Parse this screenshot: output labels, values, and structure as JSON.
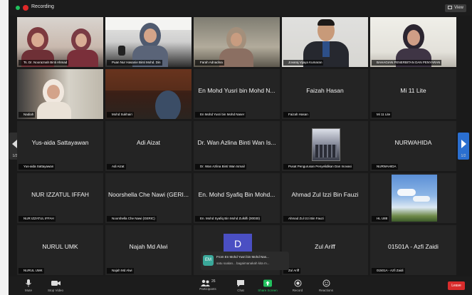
{
  "topbar": {
    "recording_label": "Recording",
    "view_label": "View"
  },
  "nav": {
    "left_page": "1/2",
    "right_page": "1/2"
  },
  "tiles": [
    {
      "name": "",
      "label": "Ts. Dr. Nooraznah Binti Ahmad"
    },
    {
      "name": "",
      "label": "Puan Nur Hasanie Binti Mohd. Din"
    },
    {
      "name": "",
      "label": "Farah Adnadina"
    },
    {
      "name": "",
      "label": "Jovaraj Vijaya Kumaran"
    },
    {
      "name": "",
      "label": "BAHAGIAN PENERBITAN DAN PENYARAN"
    },
    {
      "name": "",
      "label": "Nadiah"
    },
    {
      "name": "",
      "label": "Mohd Sukhairi"
    },
    {
      "name": "En Mohd Yusri bin Mohd N...",
      "label": "En Mohd Yusri bin Mohd Naser"
    },
    {
      "name": "Faizah Hasan",
      "label": "Faizah Hasan"
    },
    {
      "name": "Mi 11 Lite",
      "label": "Mi 11 Lite"
    },
    {
      "name": "Yus-aida Sattayawan",
      "label": "Yus-aida Sattayawan"
    },
    {
      "name": "Adi Aizat",
      "label": "Adi Aizat"
    },
    {
      "name": "Dr. Wan Azlina Binti Wan Is...",
      "label": "Dr. Wan Azlina Binti Wan Ismail"
    },
    {
      "name": "",
      "label": "Pusat Pengurusan Penyelidikan Dan Inovasi"
    },
    {
      "name": "NURWAHIDA",
      "label": "NURWAHIDA"
    },
    {
      "name": "NUR IZZATUL IFFAH",
      "label": "NUR IZZATUL IFFAH"
    },
    {
      "name": "Noorshella Che Nawi (GERI...",
      "label": "Noorshella Che Nawi (GERIC)"
    },
    {
      "name": "En. Mohd Syafiq Bin Mohd...",
      "label": "En. Mohd Syafiq Bin Mohd Zulkifli (00030)"
    },
    {
      "name": "Ahmad Zul Izzi Bin Fauzi",
      "label": "Ahmad Zul Izzi Bin Fauzi"
    },
    {
      "name": "",
      "label": "HL U88"
    },
    {
      "name": "NURUL UMK",
      "label": "NURUL UMK"
    },
    {
      "name": "Najah Md Alwi",
      "label": "Najah Md Alwi"
    },
    {
      "name": "",
      "label": ""
    },
    {
      "name": "Zul Ariff",
      "label": "Zul Ariff"
    },
    {
      "name": "01501A - Azfi Zaidi",
      "label": "01501A - Azfi Zaidi"
    }
  ],
  "chat_toast": {
    "avatar_initials": "EM",
    "from": "From En Mohd Yusri bin Mohd Nas...",
    "message": "satu soalan... bagaimanakah kita m..."
  },
  "toolbar": {
    "unmute": "Mute",
    "stop_video": "Stop Video",
    "participants": "Participants",
    "participants_count": "26",
    "chat": "Chat",
    "share_screen": "Share Screen",
    "record": "Record",
    "reactions": "Reactions",
    "leave": "Leave"
  },
  "colors": {
    "active_speaker": "#c8dd34",
    "share_green": "#21c25e",
    "leave_red": "#d82c2c",
    "nav_blue": "#2a6fd1"
  }
}
